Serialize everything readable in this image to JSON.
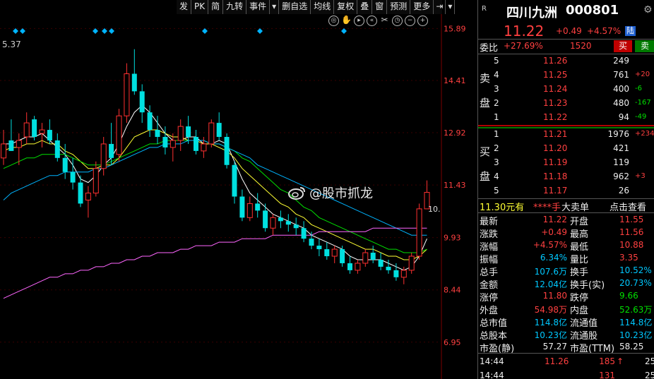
{
  "toolbar": {
    "buttons": [
      "发",
      "PK",
      "简",
      "九转",
      "事件",
      "▾",
      "删自选",
      "均线",
      "复权",
      "叠",
      "窗",
      "预测",
      "更多",
      "⇥",
      "▾"
    ]
  },
  "chart": {
    "price_labels": [
      "15.89",
      "14.41",
      "12.92",
      "11.43",
      "9.93",
      "8.44",
      "6.95"
    ],
    "ma_label": "5.37",
    "current_price_label": "10.",
    "watermark": "@股市抓龙"
  },
  "chart_data": {
    "type": "candlestick",
    "y_range": [
      5.9,
      16.3
    ],
    "y_ticks": [
      15.89,
      14.41,
      12.92,
      11.43,
      9.93,
      8.44,
      6.95
    ],
    "candles_ohlc": [
      [
        12.2,
        13.0,
        12.0,
        12.6
      ],
      [
        12.7,
        13.3,
        12.4,
        12.4
      ],
      [
        12.5,
        12.9,
        12.0,
        12.7
      ],
      [
        12.8,
        13.5,
        12.6,
        13.2
      ],
      [
        13.3,
        13.4,
        12.7,
        12.8
      ],
      [
        12.9,
        13.2,
        12.5,
        13.0
      ],
      [
        13.0,
        13.3,
        12.6,
        12.7
      ],
      [
        12.7,
        12.9,
        12.1,
        12.2
      ],
      [
        12.2,
        12.6,
        11.6,
        11.8
      ],
      [
        11.8,
        12.2,
        11.3,
        11.5
      ],
      [
        11.5,
        11.7,
        10.8,
        10.9
      ],
      [
        11.0,
        11.4,
        10.5,
        11.2
      ],
      [
        11.2,
        12.1,
        11.1,
        11.9
      ],
      [
        11.9,
        12.8,
        11.7,
        12.6
      ],
      [
        12.6,
        13.2,
        12.0,
        12.2
      ],
      [
        12.3,
        13.6,
        12.1,
        13.4
      ],
      [
        13.4,
        14.9,
        13.2,
        14.6
      ],
      [
        14.6,
        15.3,
        14.0,
        14.1
      ],
      [
        14.1,
        14.3,
        13.2,
        13.5
      ],
      [
        13.5,
        13.7,
        12.8,
        13.0
      ],
      [
        13.0,
        13.4,
        12.6,
        12.8
      ],
      [
        12.8,
        13.1,
        12.3,
        12.5
      ],
      [
        12.5,
        12.9,
        12.1,
        12.7
      ],
      [
        12.7,
        13.3,
        12.4,
        13.1
      ],
      [
        13.1,
        13.4,
        12.6,
        12.8
      ],
      [
        12.8,
        13.0,
        12.3,
        12.4
      ],
      [
        12.4,
        12.8,
        12.2,
        12.6
      ],
      [
        12.6,
        13.3,
        12.5,
        13.2
      ],
      [
        13.2,
        13.5,
        12.7,
        12.8
      ],
      [
        12.8,
        12.9,
        11.9,
        12.0
      ],
      [
        12.0,
        12.1,
        10.9,
        11.1
      ],
      [
        11.1,
        11.3,
        10.4,
        10.5
      ],
      [
        10.5,
        11.1,
        10.4,
        10.9
      ],
      [
        10.9,
        11.2,
        10.5,
        10.7
      ],
      [
        10.7,
        10.9,
        10.1,
        10.2
      ],
      [
        10.2,
        10.6,
        10.0,
        10.5
      ],
      [
        10.5,
        10.7,
        10.2,
        10.4
      ],
      [
        10.4,
        10.6,
        10.1,
        10.3
      ],
      [
        10.3,
        10.5,
        10.0,
        10.2
      ],
      [
        10.2,
        10.4,
        9.8,
        9.9
      ],
      [
        9.9,
        10.1,
        9.6,
        9.7
      ],
      [
        9.7,
        9.9,
        9.4,
        9.6
      ],
      [
        9.6,
        9.8,
        9.3,
        9.4
      ],
      [
        9.4,
        9.7,
        9.2,
        9.6
      ],
      [
        9.6,
        9.7,
        9.1,
        9.2
      ],
      [
        9.2,
        9.4,
        8.9,
        9.0
      ],
      [
        9.0,
        9.3,
        8.9,
        9.2
      ],
      [
        9.2,
        9.6,
        9.1,
        9.5
      ],
      [
        9.5,
        9.7,
        9.2,
        9.3
      ],
      [
        9.3,
        9.5,
        9.0,
        9.1
      ],
      [
        9.1,
        9.3,
        8.9,
        9.0
      ],
      [
        9.0,
        9.2,
        8.7,
        8.8
      ],
      [
        8.8,
        9.1,
        8.6,
        9.0
      ],
      [
        9.0,
        9.5,
        8.9,
        9.4
      ],
      [
        9.4,
        10.9,
        9.3,
        10.75
      ],
      [
        10.75,
        11.56,
        10.75,
        11.22
      ]
    ],
    "ma_lines": [
      {
        "color": "#ffffff",
        "points": [
          12.6,
          12.6,
          12.7,
          12.8,
          12.8,
          12.9,
          12.7,
          12.5,
          12.3,
          12.0,
          11.6,
          11.5,
          11.7,
          12.0,
          12.2,
          12.6,
          13.1,
          13.5,
          13.7,
          13.5,
          13.2,
          12.9,
          12.7,
          12.7,
          12.8,
          12.8,
          12.6,
          12.6,
          12.7,
          12.6,
          12.1,
          11.6,
          11.2,
          11.0,
          10.8,
          10.6,
          10.5,
          10.4,
          10.3,
          10.2,
          10.0,
          9.9,
          9.8,
          9.7,
          9.6,
          9.4,
          9.3,
          9.3,
          9.3,
          9.3,
          9.2,
          9.1,
          9.0,
          9.1,
          9.4,
          9.9
        ]
      },
      {
        "color": "#ffff33",
        "points": [
          12.4,
          12.5,
          12.5,
          12.6,
          12.6,
          12.7,
          12.6,
          12.6,
          12.4,
          12.3,
          12.1,
          11.9,
          11.9,
          12.0,
          12.0,
          12.2,
          12.5,
          12.8,
          12.9,
          13.0,
          13.0,
          12.9,
          12.8,
          12.8,
          12.7,
          12.7,
          12.6,
          12.6,
          12.5,
          12.4,
          12.2,
          11.9,
          11.7,
          11.5,
          11.3,
          11.1,
          10.9,
          10.8,
          10.6,
          10.5,
          10.3,
          10.2,
          10.1,
          10.0,
          9.9,
          9.8,
          9.7,
          9.6,
          9.6,
          9.5,
          9.4,
          9.4,
          9.3,
          9.3,
          9.4,
          9.6
        ]
      },
      {
        "color": "#00e000",
        "points": [
          11.9,
          12.0,
          12.1,
          12.2,
          12.2,
          12.3,
          12.3,
          12.3,
          12.3,
          12.2,
          12.1,
          12.0,
          12.0,
          12.0,
          12.1,
          12.2,
          12.3,
          12.4,
          12.5,
          12.6,
          12.6,
          12.7,
          12.7,
          12.7,
          12.7,
          12.7,
          12.7,
          12.6,
          12.6,
          12.5,
          12.4,
          12.2,
          12.1,
          11.9,
          11.7,
          11.5,
          11.3,
          11.2,
          11.0,
          10.8,
          10.7,
          10.5,
          10.4,
          10.3,
          10.2,
          10.1,
          10.0,
          9.9,
          9.8,
          9.7,
          9.6,
          9.6,
          9.5,
          9.5,
          9.5,
          9.6
        ]
      },
      {
        "color": "#00b4ff",
        "points": [
          11.0,
          11.2,
          11.3,
          11.4,
          11.5,
          11.6,
          11.7,
          11.7,
          11.8,
          11.8,
          11.8,
          11.8,
          11.9,
          11.9,
          12.0,
          12.1,
          12.2,
          12.3,
          12.4,
          12.5,
          12.5,
          12.6,
          12.6,
          12.6,
          12.7,
          12.7,
          12.7,
          12.6,
          12.6,
          12.5,
          12.4,
          12.3,
          12.2,
          12.0,
          11.9,
          11.8,
          11.7,
          11.6,
          11.5,
          11.4,
          11.3,
          11.2,
          11.1,
          11.0,
          10.9,
          10.8,
          10.7,
          10.6,
          10.5,
          10.4,
          10.3,
          10.2,
          10.1,
          10.0,
          10.0,
          10.0
        ]
      },
      {
        "color": "#ff66ff",
        "points": [
          8.2,
          8.3,
          8.4,
          8.5,
          8.6,
          8.7,
          8.8,
          8.8,
          8.9,
          8.9,
          9.0,
          9.0,
          9.1,
          9.1,
          9.2,
          9.2,
          9.3,
          9.3,
          9.4,
          9.4,
          9.5,
          9.5,
          9.5,
          9.6,
          9.6,
          9.7,
          9.7,
          9.7,
          9.8,
          9.8,
          9.8,
          9.9,
          9.9,
          9.9,
          9.9,
          10.0,
          10.0,
          10.0,
          10.0,
          10.0,
          10.0,
          10.1,
          10.1,
          10.1,
          10.1,
          10.1,
          10.1,
          10.1,
          10.2,
          10.2,
          10.2,
          10.2,
          10.2,
          10.2,
          10.2,
          10.2
        ]
      }
    ]
  },
  "panel": {
    "brand": "R",
    "stock_name": "四川九洲",
    "stock_code": "000801",
    "price": "11.22",
    "change": "+0.49",
    "change_pct": "+4.57%",
    "tag": "陆",
    "weibi_label": "委比",
    "weibi_value": "+27.69%",
    "weibi_num": "1520",
    "buy_btn": "买",
    "sell_btn": "卖",
    "sell_side_label": [
      "卖",
      "盘"
    ],
    "buy_side_label": [
      "买",
      "盘"
    ],
    "asks": [
      {
        "level": "5",
        "price": "11.26",
        "vol": "249",
        "chg": ""
      },
      {
        "level": "4",
        "price": "11.25",
        "vol": "761",
        "chg": "+20"
      },
      {
        "level": "3",
        "price": "11.24",
        "vol": "400",
        "chg": "-6"
      },
      {
        "level": "2",
        "price": "11.23",
        "vol": "480",
        "chg": "-167"
      },
      {
        "level": "1",
        "price": "11.22",
        "vol": "94",
        "chg": "-49"
      }
    ],
    "bids": [
      {
        "level": "1",
        "price": "11.21",
        "vol": "1976",
        "chg": "+234"
      },
      {
        "level": "2",
        "price": "11.20",
        "vol": "421",
        "chg": ""
      },
      {
        "level": "3",
        "price": "11.19",
        "vol": "119",
        "chg": ""
      },
      {
        "level": "4",
        "price": "11.18",
        "vol": "962",
        "chg": "+3"
      },
      {
        "level": "5",
        "price": "11.17",
        "vol": "26",
        "chg": ""
      }
    ],
    "big_order": {
      "left": "11.30元有",
      "stars": "****手",
      "mid": "大卖单",
      "link": "点击查看"
    },
    "stats": [
      {
        "l1": "最新",
        "v1": "11.22",
        "c1": "red",
        "l2": "开盘",
        "v2": "11.55",
        "c2": "red"
      },
      {
        "l1": "涨跌",
        "v1": "+0.49",
        "c1": "red",
        "l2": "最高",
        "v2": "11.56",
        "c2": "red"
      },
      {
        "l1": "涨幅",
        "v1": "+4.57%",
        "c1": "red",
        "l2": "最低",
        "v2": "10.88",
        "c2": "red"
      },
      {
        "l1": "振幅",
        "v1": "6.34%",
        "c1": "cyan",
        "l2": "量比",
        "v2": "3.35",
        "c2": "red"
      },
      {
        "l1": "总手",
        "v1": "107.6万",
        "c1": "cyan",
        "l2": "换手",
        "v2": "10.52%",
        "c2": "cyan"
      },
      {
        "l1": "金额",
        "v1": "12.04亿",
        "c1": "cyan",
        "l2": "换手(实)",
        "v2": "20.73%",
        "c2": "cyan"
      },
      {
        "l1": "涨停",
        "v1": "11.80",
        "c1": "red",
        "l2": "跌停",
        "v2": "9.66",
        "c2": "green"
      },
      {
        "l1": "外盘",
        "v1": "54.98万",
        "c1": "red",
        "l2": "内盘",
        "v2": "52.63万",
        "c2": "green"
      },
      {
        "l1": "总市值",
        "v1": "114.8亿",
        "c1": "cyan",
        "l2": "流通值",
        "v2": "114.8亿",
        "c2": "cyan"
      },
      {
        "l1": "总股本",
        "v1": "10.23亿",
        "c1": "cyan",
        "l2": "流通股",
        "v2": "10.23亿",
        "c2": "cyan"
      },
      {
        "l1": "市盈(静)",
        "v1": "57.27",
        "c1": "white",
        "l2": "市盈(TTM)",
        "v2": "58.25",
        "c2": "white"
      }
    ],
    "ticks": [
      {
        "time": "14:44",
        "price": "11.26",
        "vol": "185",
        "arrow": "↑",
        "num": "25"
      },
      {
        "time": "14:44",
        "price": "",
        "vol": "131",
        "arrow": "",
        "num": "25"
      }
    ]
  }
}
